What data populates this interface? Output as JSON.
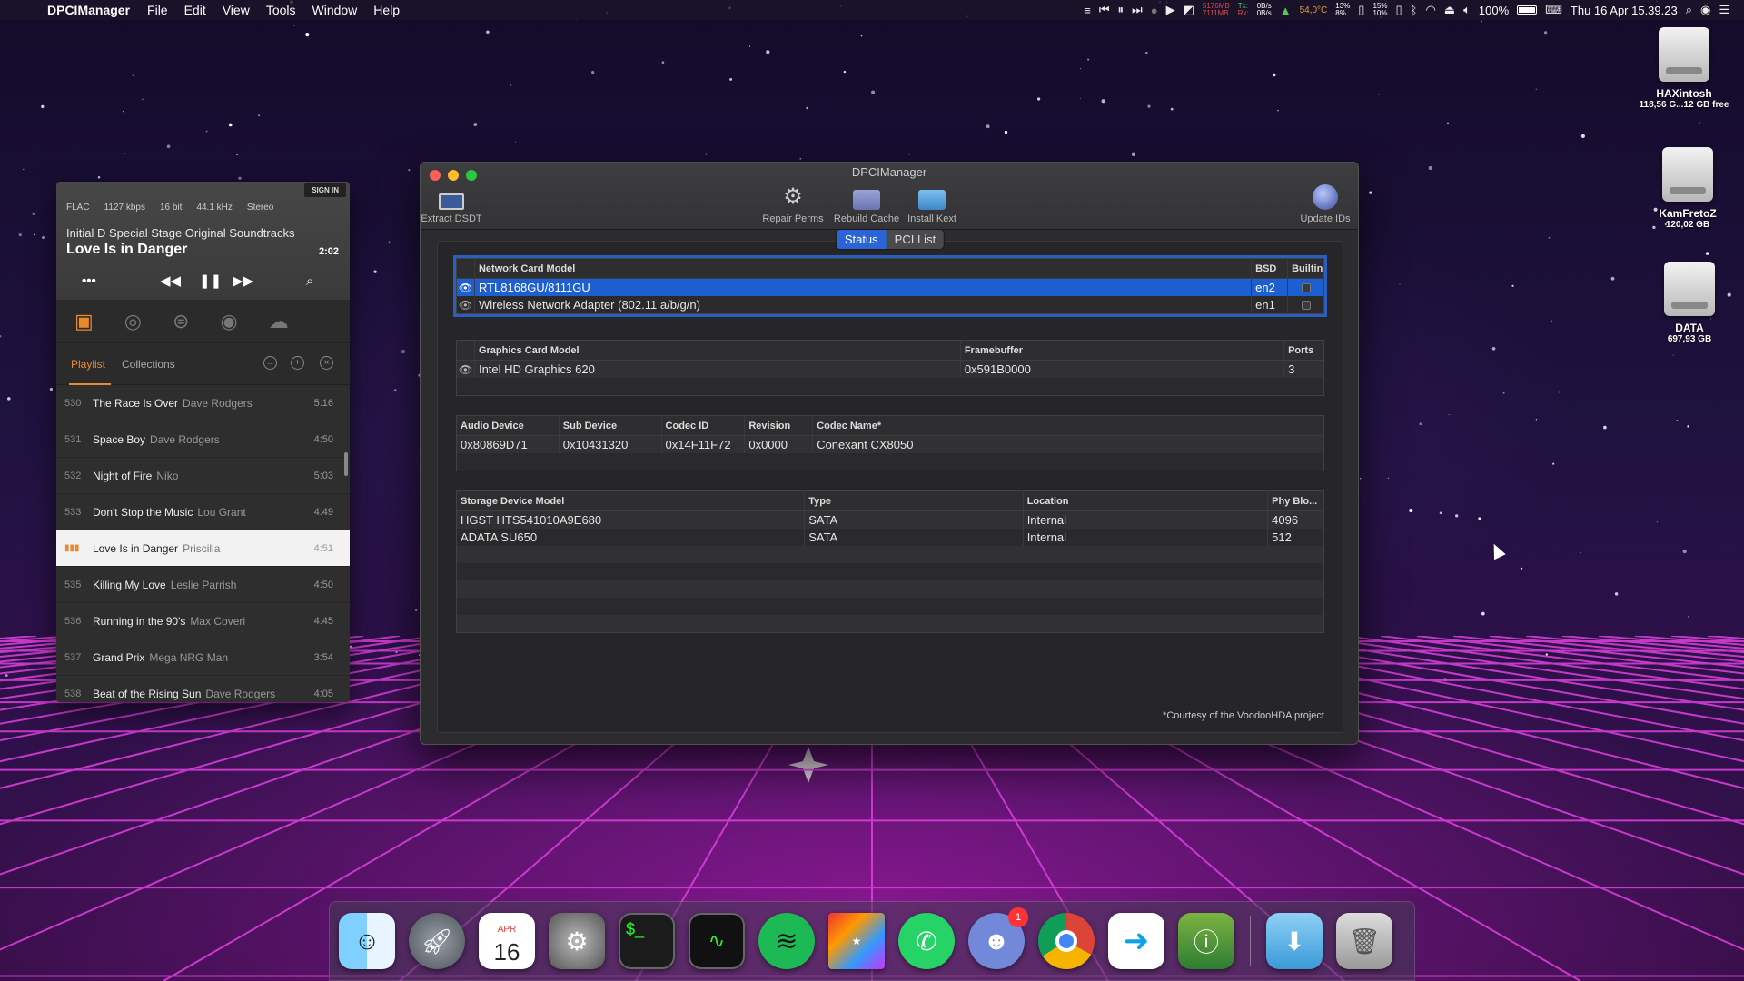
{
  "menubar": {
    "app_name": "DPCIManager",
    "menus": [
      "File",
      "Edit",
      "View",
      "Tools",
      "Window",
      "Help"
    ],
    "status": {
      "mem_used": "5176MB",
      "mem_free": "7111MB",
      "net_tx": "Tx:",
      "net_rx": "Rx:",
      "net_up": "0B/s",
      "net_down": "0B/s",
      "temp": "54,0°C",
      "cpu1": "13%",
      "cpu2": "8%",
      "cpu3": "15%",
      "cpu4": "10%",
      "battery": "100%",
      "datetime": "Thu 16 Apr  15.39.23"
    }
  },
  "desktop_icons": [
    {
      "name": "HAXintosh",
      "size": "118,56 G...12 GB free"
    },
    {
      "name": "KamFretoZ",
      "size": "120,02 GB"
    },
    {
      "name": "DATA",
      "size": "697,93 GB"
    }
  ],
  "player": {
    "sign_in": "SIGN IN",
    "format": [
      "FLAC",
      "1127 kbps",
      "16 bit",
      "44.1 kHz",
      "Stereo"
    ],
    "album": "Initial D Special Stage Original Soundtracks",
    "song": "Love Is in Danger",
    "time": "2:02",
    "tabs": {
      "playlist": "Playlist",
      "collections": "Collections"
    },
    "tracks": [
      {
        "num": "530",
        "title": "The Race Is Over",
        "artist": "Dave Rodgers",
        "duration": "5:16",
        "current": false
      },
      {
        "num": "531",
        "title": "Space Boy",
        "artist": "Dave Rodgers",
        "duration": "4:50",
        "current": false
      },
      {
        "num": "532",
        "title": "Night of Fire",
        "artist": "Niko",
        "duration": "5:03",
        "current": false
      },
      {
        "num": "533",
        "title": "Don't Stop the Music",
        "artist": "Lou Grant",
        "duration": "4:49",
        "current": false
      },
      {
        "num": "",
        "title": "Love Is in Danger",
        "artist": "Priscilla",
        "duration": "4:51",
        "current": true
      },
      {
        "num": "535",
        "title": "Killing My Love",
        "artist": "Leslie Parrish",
        "duration": "4:50",
        "current": false
      },
      {
        "num": "536",
        "title": "Running in the 90's",
        "artist": "Max Coveri",
        "duration": "4:45",
        "current": false
      },
      {
        "num": "537",
        "title": "Grand Prix",
        "artist": "Mega NRG Man",
        "duration": "3:54",
        "current": false
      },
      {
        "num": "538",
        "title": "Beat of the Rising Sun",
        "artist": "Dave Rodgers",
        "duration": "4:05",
        "current": false
      }
    ]
  },
  "window": {
    "title": "DPCIManager",
    "toolbar": {
      "extract_dsdt": "Extract DSDT",
      "repair_perms": "Repair Perms",
      "rebuild_cache": "Rebuild Cache",
      "install_kext": "Install Kext",
      "update_ids": "Update IDs"
    },
    "segments": {
      "status": "Status",
      "pci_list": "PCI List"
    },
    "network": {
      "headers": [
        "Network Card Model",
        "BSD",
        "Builtin"
      ],
      "rows": [
        {
          "model": "RTL8168GU/8111GU",
          "bsd": "en2",
          "builtin": true
        },
        {
          "model": "Wireless Network Adapter (802.11 a/b/g/n)",
          "bsd": "en1",
          "builtin": true
        }
      ]
    },
    "graphics": {
      "headers": [
        "Graphics Card Model",
        "Framebuffer",
        "Ports"
      ],
      "rows": [
        {
          "model": "Intel HD Graphics 620",
          "framebuffer": "0x591B0000",
          "ports": "3"
        }
      ]
    },
    "audio": {
      "headers": [
        "Audio Device",
        "Sub Device",
        "Codec ID",
        "Revision",
        "Codec Name*"
      ],
      "rows": [
        {
          "device": "0x80869D71",
          "sub": "0x10431320",
          "codec": "0x14F11F72",
          "revision": "0x0000",
          "name": "Conexant CX8050"
        }
      ]
    },
    "storage": {
      "headers": [
        "Storage Device Model",
        "Type",
        "Location",
        "Phy Blo..."
      ],
      "rows": [
        {
          "model": "HGST HTS541010A9E680",
          "type": "SATA",
          "location": "Internal",
          "phy": "4096"
        },
        {
          "model": "ADATA SU650",
          "type": "SATA",
          "location": "Internal",
          "phy": "512"
        }
      ]
    },
    "footer": "*Courtesy of the VoodooHDA project"
  },
  "dock": [
    "Finder",
    "Launchpad",
    "Calendar",
    "System Preferences",
    "Terminal",
    "Activity Monitor",
    "Spotify",
    "Game",
    "WhatsApp",
    "Discord",
    "Chrome",
    "Transfer",
    "System Information",
    "Downloads",
    "Trash"
  ],
  "calendar": {
    "month": "APR",
    "day": "16"
  },
  "discord_badge": "1",
  "colors": {
    "accent": "#2a64d6",
    "player_accent": "#e88a2c",
    "grid": "#e040e0"
  }
}
